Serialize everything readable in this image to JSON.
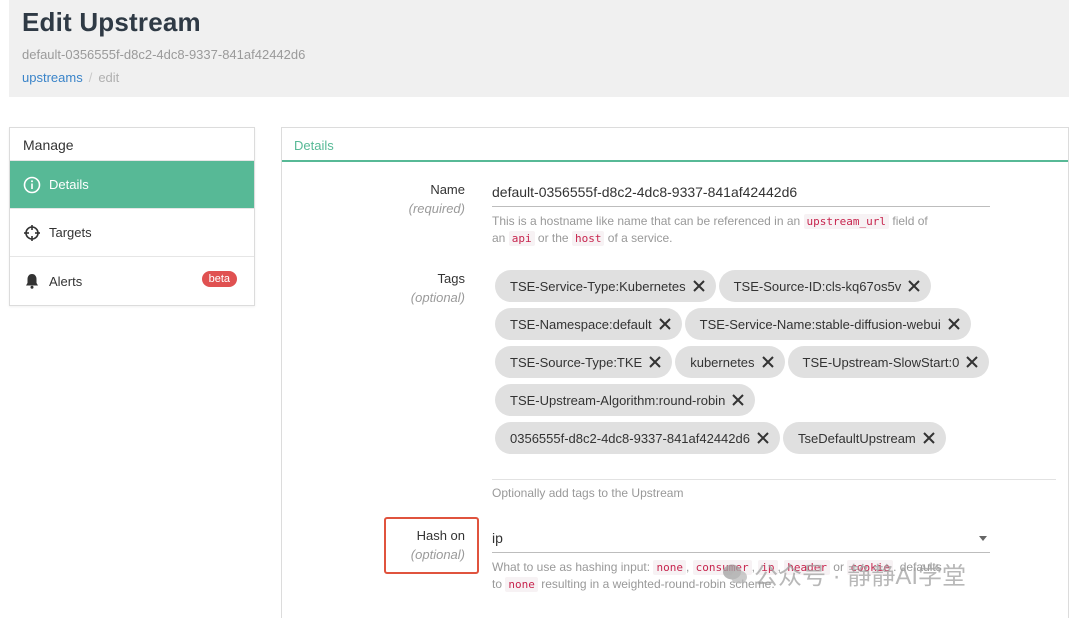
{
  "header": {
    "title": "Edit Upstream",
    "id": "default-0356555f-d8c2-4dc8-9337-841af42442d6",
    "breadcrumb": {
      "link": "upstreams",
      "separator": "/",
      "current": "edit"
    }
  },
  "sidebar": {
    "title": "Manage",
    "items": [
      {
        "label": "Details",
        "icon": "info-icon",
        "active": true
      },
      {
        "label": "Targets",
        "icon": "crosshair-icon",
        "active": false
      },
      {
        "label": "Alerts",
        "icon": "bell-icon",
        "active": false,
        "badge": "beta"
      }
    ]
  },
  "panel": {
    "title": "Details",
    "name": {
      "label": "Name",
      "sub": "(required)",
      "value": "default-0356555f-d8c2-4dc8-9337-841af42442d6",
      "help": {
        "a": "This is a hostname like name that can be referenced in an",
        "c1": "upstream_url",
        "b": "field of",
        "c": "an",
        "c2": "api",
        "d": "or the",
        "c3": "host",
        "e": "of a service."
      }
    },
    "tags": {
      "label": "Tags",
      "sub": "(optional)",
      "items": [
        "TSE-Service-Type:Kubernetes",
        "TSE-Source-ID:cls-kq67os5v",
        "TSE-Namespace:default",
        "TSE-Service-Name:stable-diffusion-webui",
        "TSE-Source-Type:TKE",
        "kubernetes",
        "TSE-Upstream-SlowStart:0",
        "TSE-Upstream-Algorithm:round-robin",
        "0356555f-d8c2-4dc8-9337-841af42442d6",
        "TseDefaultUpstream"
      ],
      "help": "Optionally add tags to the Upstream"
    },
    "hash_on": {
      "label": "Hash on",
      "sub": "(optional)",
      "value": "ip",
      "help": {
        "a": "What to use as hashing input:",
        "c1": "none",
        "c2": "consumer",
        "c3": "ip",
        "c4": "header",
        "b": "or",
        "c5": "cookie",
        "d": ". defaults",
        "e": "to",
        "c6": "none",
        "f": "resulting in a weighted-round-robin scheme."
      }
    }
  },
  "watermark": "公众号 · 静静AI学堂",
  "colors": {
    "accent": "#57b996",
    "link": "#3a84c9",
    "badge": "#e05151",
    "highlight_box": "#e0533e"
  }
}
